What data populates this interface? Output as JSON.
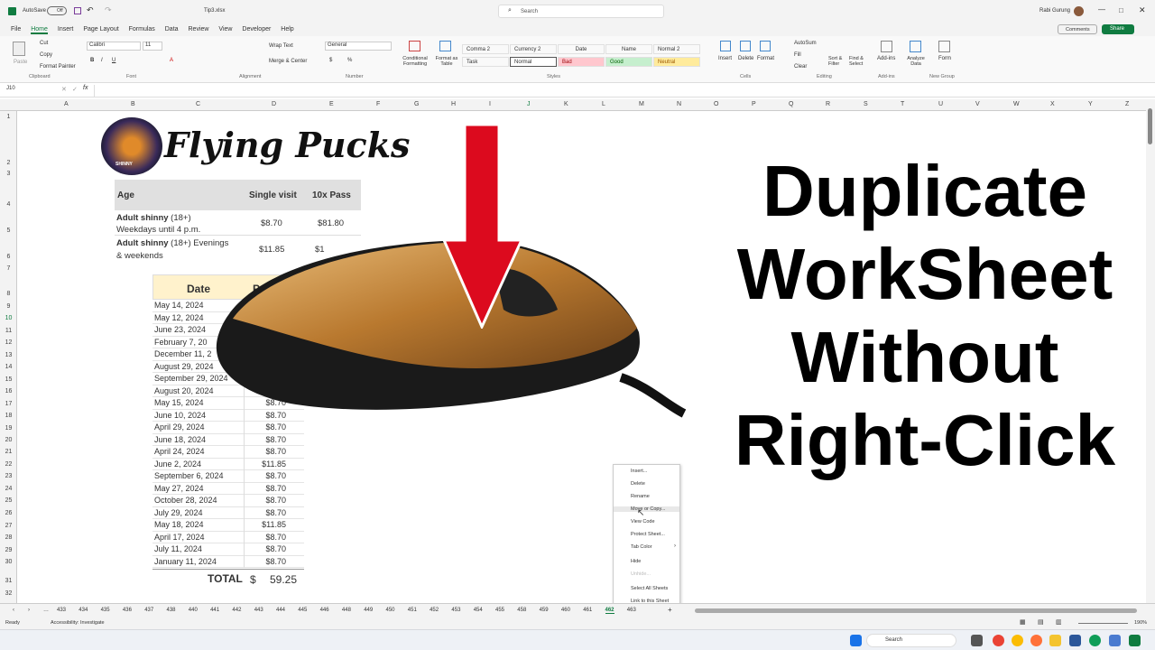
{
  "app": {
    "autosave": "AutoSave",
    "autosave_state": "Off",
    "filename": "Tip3.xlsx",
    "search": "Search",
    "user": "Rabi Gurung",
    "comments": "Comments",
    "share": "Share"
  },
  "menu": [
    "File",
    "Home",
    "Insert",
    "Page Layout",
    "Formulas",
    "Data",
    "Review",
    "View",
    "Developer",
    "Help"
  ],
  "ribbon": {
    "clipboard": {
      "paste": "Paste",
      "cut": "Cut",
      "copy": "Copy",
      "painter": "Format Painter",
      "label": "Clipboard"
    },
    "font": {
      "name": "Calibri",
      "size": "11",
      "label": "Font"
    },
    "alignment": {
      "wrap": "Wrap Text",
      "merge": "Merge & Center",
      "label": "Alignment"
    },
    "number": {
      "format": "General",
      "label": "Number"
    },
    "styles": {
      "cond": "Conditional Formatting",
      "fmt_table": "Format as Table",
      "comma2": "Comma 2",
      "currency2": "Currency 2",
      "date": "Date",
      "name": "Name",
      "normal2": "Normal 2",
      "task": "Task",
      "normal": "Normal",
      "bad": "Bad",
      "good": "Good",
      "neutral": "Neutral",
      "label": "Styles"
    },
    "cells": {
      "insert": "Insert",
      "delete": "Delete",
      "format": "Format",
      "label": "Cells"
    },
    "editing": {
      "autosum": "AutoSum",
      "fill": "Fill",
      "clear": "Clear",
      "sort": "Sort & Filter",
      "find": "Find & Select",
      "label": "Editing"
    },
    "addins": {
      "addins": "Add-ins",
      "analyze": "Analyze Data",
      "label": "Add-ins"
    },
    "form": {
      "form": "Form",
      "label": "New Group"
    }
  },
  "namebox": "J10",
  "columns": [
    "A",
    "B",
    "C",
    "D",
    "E",
    "F",
    "G",
    "H",
    "I",
    "J",
    "K",
    "L",
    "M",
    "N",
    "O",
    "P",
    "Q",
    "R",
    "S",
    "T",
    "U",
    "V",
    "W",
    "X",
    "Y",
    "Z"
  ],
  "rows": [
    "1",
    "2",
    "3",
    "4",
    "5",
    "6",
    "7",
    "8",
    "9",
    "10",
    "11",
    "12",
    "13",
    "14",
    "15",
    "16",
    "17",
    "18",
    "19",
    "20",
    "21",
    "22",
    "23",
    "24",
    "25",
    "26",
    "27",
    "28",
    "29",
    "30",
    "31",
    "32"
  ],
  "logo": {
    "text": "Flying Pucks",
    "badge": "SHINNY"
  },
  "price_table": {
    "headers": [
      "Age",
      "Single visit",
      "10x Pass"
    ],
    "rows": [
      {
        "label": "Adult shinny",
        "qual": " (18+)",
        "sub": "Weekdays until 4 p.m.",
        "single": "$8.70",
        "pass": "$81.80"
      },
      {
        "label": "Adult shinny",
        "qual": " (18+) Evenings",
        "sub": "& weekends",
        "single": "$11.85",
        "pass": "$1"
      }
    ]
  },
  "date_table": {
    "headers": [
      "Date",
      "P"
    ],
    "rows": [
      {
        "date": "May 14, 2024",
        "price": ""
      },
      {
        "date": "May 12, 2024",
        "price": ""
      },
      {
        "date": "June 23, 2024",
        "price": ""
      },
      {
        "date": "February 7, 20",
        "price": ""
      },
      {
        "date": "December 11, 2",
        "price": ""
      },
      {
        "date": "August 29, 2024",
        "price": ""
      },
      {
        "date": "September 29, 2024",
        "price": ""
      },
      {
        "date": "August 20, 2024",
        "price": ""
      },
      {
        "date": "May 15, 2024",
        "price": "$8.70"
      },
      {
        "date": "June 10, 2024",
        "price": "$8.70"
      },
      {
        "date": "April 29, 2024",
        "price": "$8.70"
      },
      {
        "date": "June 18, 2024",
        "price": "$8.70"
      },
      {
        "date": "April 24, 2024",
        "price": "$8.70"
      },
      {
        "date": "June 2, 2024",
        "price": "$11.85"
      },
      {
        "date": "September 6, 2024",
        "price": "$8.70"
      },
      {
        "date": "May 27, 2024",
        "price": "$8.70"
      },
      {
        "date": "October 28, 2024",
        "price": "$8.70"
      },
      {
        "date": "July 29, 2024",
        "price": "$8.70"
      },
      {
        "date": "May 18, 2024",
        "price": "$11.85"
      },
      {
        "date": "April 17, 2024",
        "price": "$8.70"
      },
      {
        "date": "July 11, 2024",
        "price": "$8.70"
      },
      {
        "date": "January 11, 2024",
        "price": "$8.70"
      }
    ],
    "total_label": "TOTAL",
    "total_currency": "$",
    "total_value": "59.25"
  },
  "headline": [
    "Duplicate",
    "WorkSheet",
    "Without",
    "Right-Click"
  ],
  "context_menu": [
    "Insert...",
    "Delete",
    "Rename",
    "Move or Copy...",
    "View Code",
    "Protect Sheet...",
    "Tab Color",
    "Hide",
    "Unhide...",
    "Select All Sheets",
    "Link to this Sheet"
  ],
  "sheet_tabs": [
    "433",
    "434",
    "435",
    "436",
    "437",
    "438",
    "440",
    "441",
    "442",
    "443",
    "444",
    "445",
    "446",
    "448",
    "449",
    "450",
    "451",
    "452",
    "453",
    "454",
    "455",
    "458",
    "459",
    "460",
    "461",
    "462",
    "463"
  ],
  "active_sheet": "462",
  "status": {
    "ready": "Ready",
    "accessibility": "Accessibility: Investigate",
    "zoom": "190%"
  },
  "taskbar": {
    "search": "Search"
  }
}
